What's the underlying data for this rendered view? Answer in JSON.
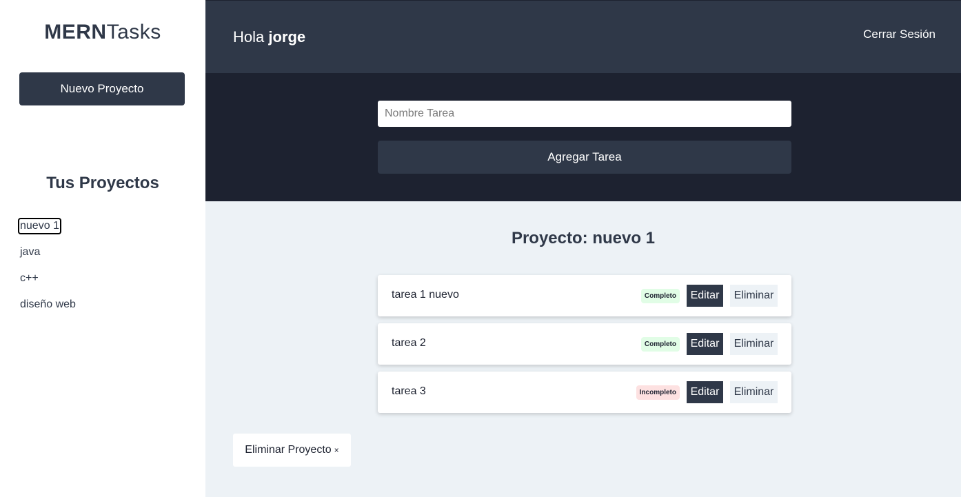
{
  "sidebar": {
    "logo_bold": "MERN",
    "logo_light": "Tasks",
    "new_project_label": "Nuevo Proyecto",
    "projects_title": "Tus Proyectos",
    "projects": [
      {
        "name": "nuevo 1",
        "active": true
      },
      {
        "name": "java",
        "active": false
      },
      {
        "name": "c++",
        "active": false
      },
      {
        "name": "diseño web",
        "active": false
      }
    ]
  },
  "header": {
    "greeting_prefix": "Hola ",
    "user_name": "jorge",
    "logout_label": "Cerrar Sesión"
  },
  "task_form": {
    "input_value": "",
    "input_placeholder": "Nombre Tarea",
    "submit_label": "Agregar Tarea"
  },
  "main": {
    "project_heading_prefix": "Proyecto: ",
    "project_name": "nuevo 1",
    "tasks": [
      {
        "name": "tarea 1 nuevo",
        "status": "Completo",
        "status_kind": "complete",
        "edit_label": "Editar",
        "delete_label": "Eliminar"
      },
      {
        "name": "tarea 2",
        "status": "Completo",
        "status_kind": "complete",
        "edit_label": "Editar",
        "delete_label": "Eliminar"
      },
      {
        "name": "tarea 3",
        "status": "Incompleto",
        "status_kind": "incomplete",
        "edit_label": "Editar",
        "delete_label": "Eliminar"
      }
    ],
    "delete_project_label": "Eliminar Proyecto",
    "delete_project_icon": "×"
  },
  "colors": {
    "primary_dark": "#2f3848",
    "darker": "#1d2230",
    "background": "#edf2f6",
    "complete_badge": "#e1fde6",
    "incomplete_badge": "#fde1e1"
  }
}
